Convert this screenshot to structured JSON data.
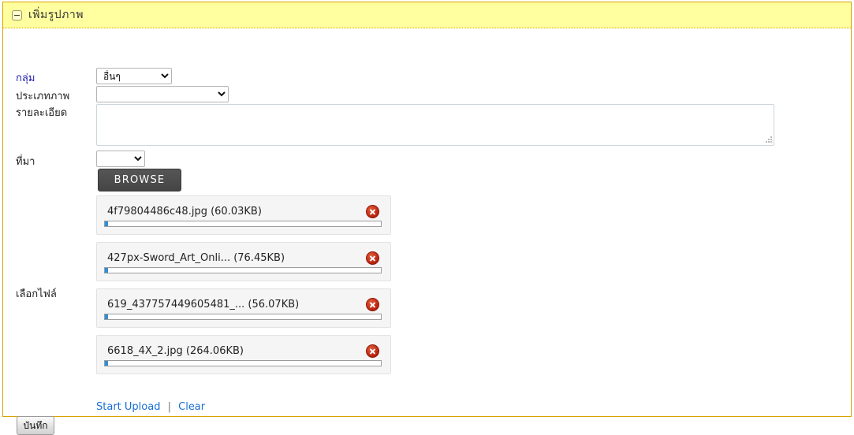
{
  "panel": {
    "title": "เพิ่มรูปภาพ",
    "collapse_icon": "minus-box-icon",
    "header_bg": "#ffffa0",
    "border_color": "#d9a300"
  },
  "form": {
    "fields": [
      {
        "label": "กลุ่ม",
        "value": "อื่นๆ",
        "color": "#1f1fa8"
      },
      {
        "label": "ประเภทภาพ",
        "value": ""
      },
      {
        "label": "รายละเอียด",
        "value": "",
        "placeholder": ""
      },
      {
        "label": "ที่มา",
        "value": ""
      },
      {
        "label": "เลือกไฟล์"
      }
    ]
  },
  "browse": {
    "label": "BROWSE"
  },
  "files": [
    {
      "name": "4f79804486c48.jpg (60.03KB)",
      "progress": 1,
      "delete_icon": "delete-circle-icon"
    },
    {
      "name": "427px-Sword_Art_Onli... (76.45KB)",
      "progress": 1,
      "delete_icon": "delete-circle-icon"
    },
    {
      "name": "619_437757449605481_... (56.07KB)",
      "progress": 1,
      "delete_icon": "delete-circle-icon"
    },
    {
      "name": "6618_4X_2.jpg (264.06KB)",
      "progress": 1,
      "delete_icon": "delete-circle-icon"
    }
  ],
  "actions": {
    "start_upload": "Start Upload",
    "separator": "|",
    "clear": "Clear",
    "link_color": "#1a6fd4"
  },
  "save": {
    "label": "บันทึก"
  }
}
